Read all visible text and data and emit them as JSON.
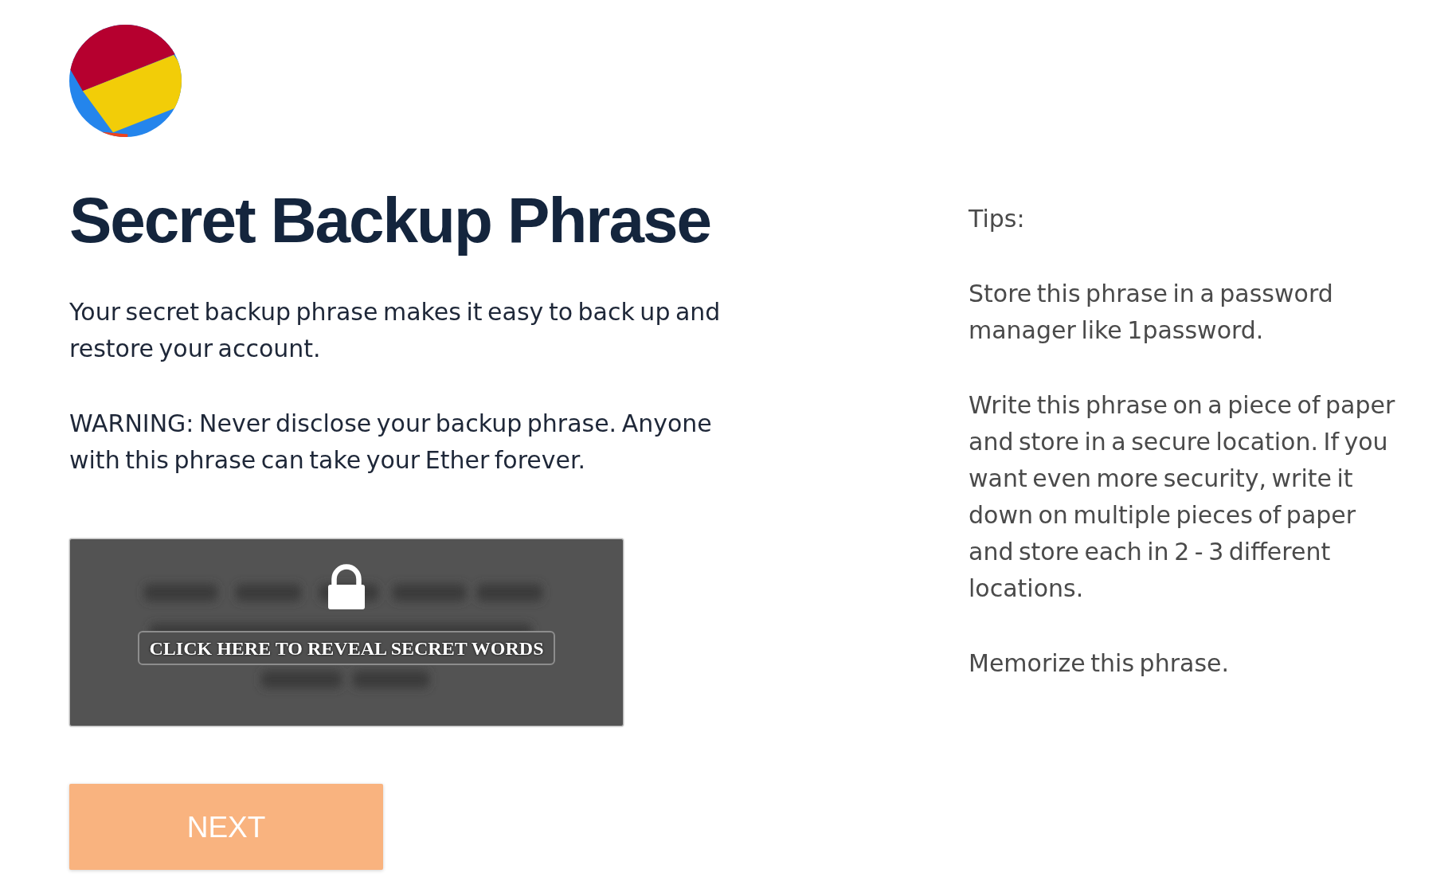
{
  "title": "Secret Backup Phrase",
  "paragraphs": [
    "Your secret backup phrase makes it easy to back up and restore your account.",
    "WARNING: Never disclose your backup phrase. Anyone with this phrase can take your Ether forever."
  ],
  "secret_words_panel": {
    "reveal_button": "CLICK HERE TO REVEAL SECRET WORDS"
  },
  "next_button": "NEXT",
  "tips": {
    "heading": "Tips:",
    "items": [
      "Store this phrase in a password manager like 1password.",
      "Write this phrase on a piece of paper and store in a secure location. If you want even more security, write it down on multiple pieces of paper and store each in 2 - 3 different locations.",
      "Memorize this phrase."
    ]
  }
}
